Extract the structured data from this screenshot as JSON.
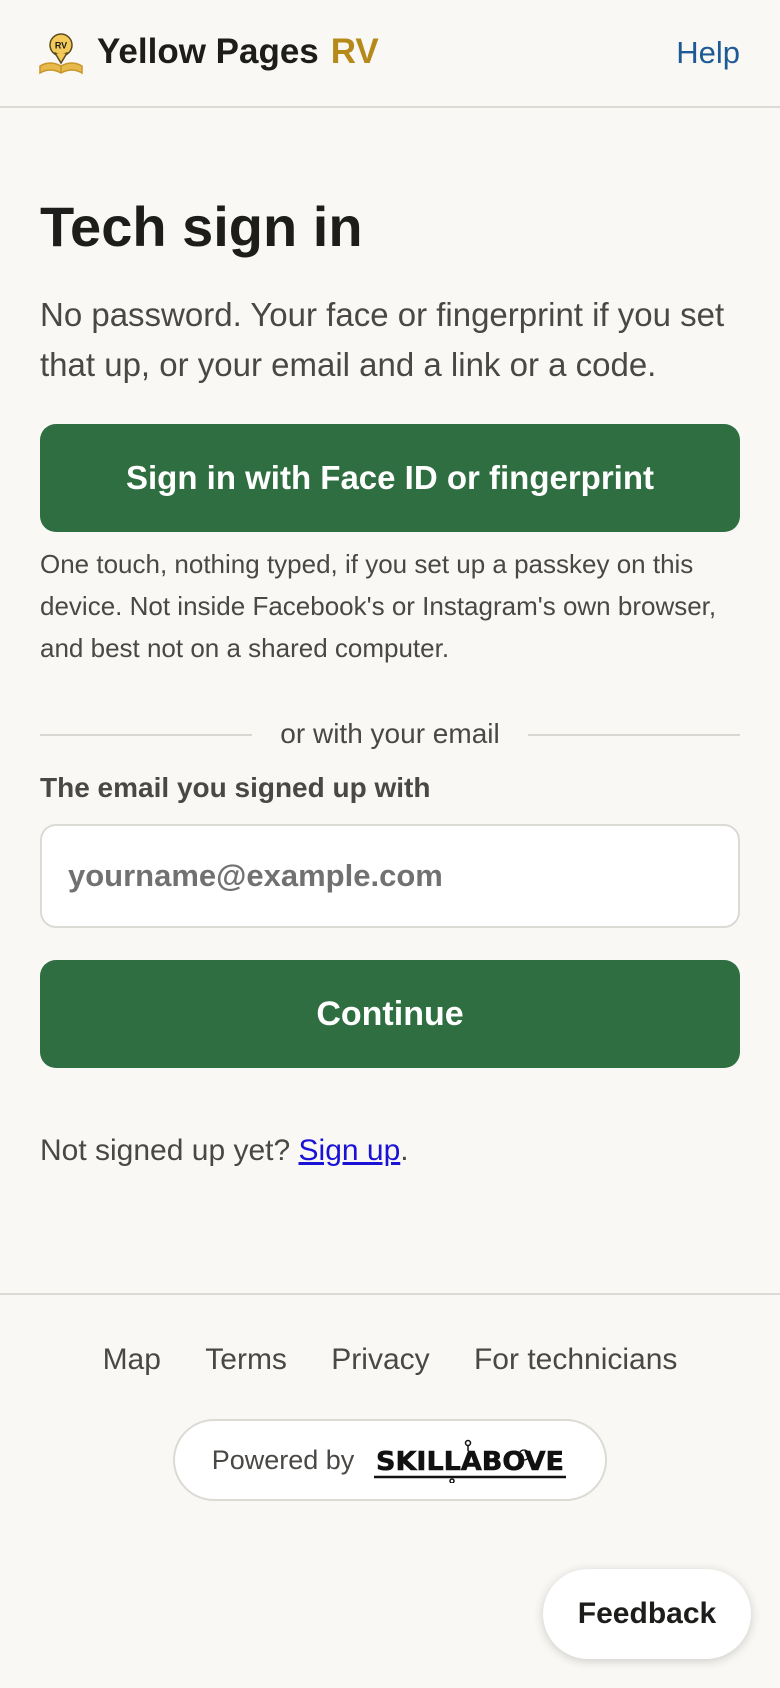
{
  "header": {
    "brand_name": "Yellow Pages",
    "brand_suffix": "RV",
    "logo_badge": "RV",
    "help_label": "Help"
  },
  "main": {
    "title": "Tech sign in",
    "intro": "No password. Your face or fingerprint if you set that up, or your email and a link or a code.",
    "passkey_button_label": "Sign in with Face ID or fingerprint",
    "passkey_note": "One touch, nothing typed, if you set up a passkey on this device. Not inside Facebook's or Instagram's own browser, and best not on a shared computer.",
    "divider_text": "or with your email",
    "email_label": "The email you signed up with",
    "email_placeholder": "yourname@example.com",
    "email_value": "",
    "continue_label": "Continue",
    "signup_prompt": "Not signed up yet?",
    "signup_link": "Sign up",
    "signup_suffix": "."
  },
  "footer": {
    "links": [
      "Map",
      "Terms",
      "Privacy",
      "For technicians"
    ],
    "powered_by_label": "Powered by",
    "powered_by_brand": "SKILLABOVE"
  },
  "feedback_label": "Feedback",
  "colors": {
    "background": "#faf8f4",
    "primary_button": "#2e6e40",
    "brand_accent": "#b5891a",
    "help_link": "#1f5a96",
    "signup_link": "#1a13d6"
  },
  "icons": {
    "logo": "map-pin-book-icon",
    "powered_logo": "skill-above-logo"
  }
}
